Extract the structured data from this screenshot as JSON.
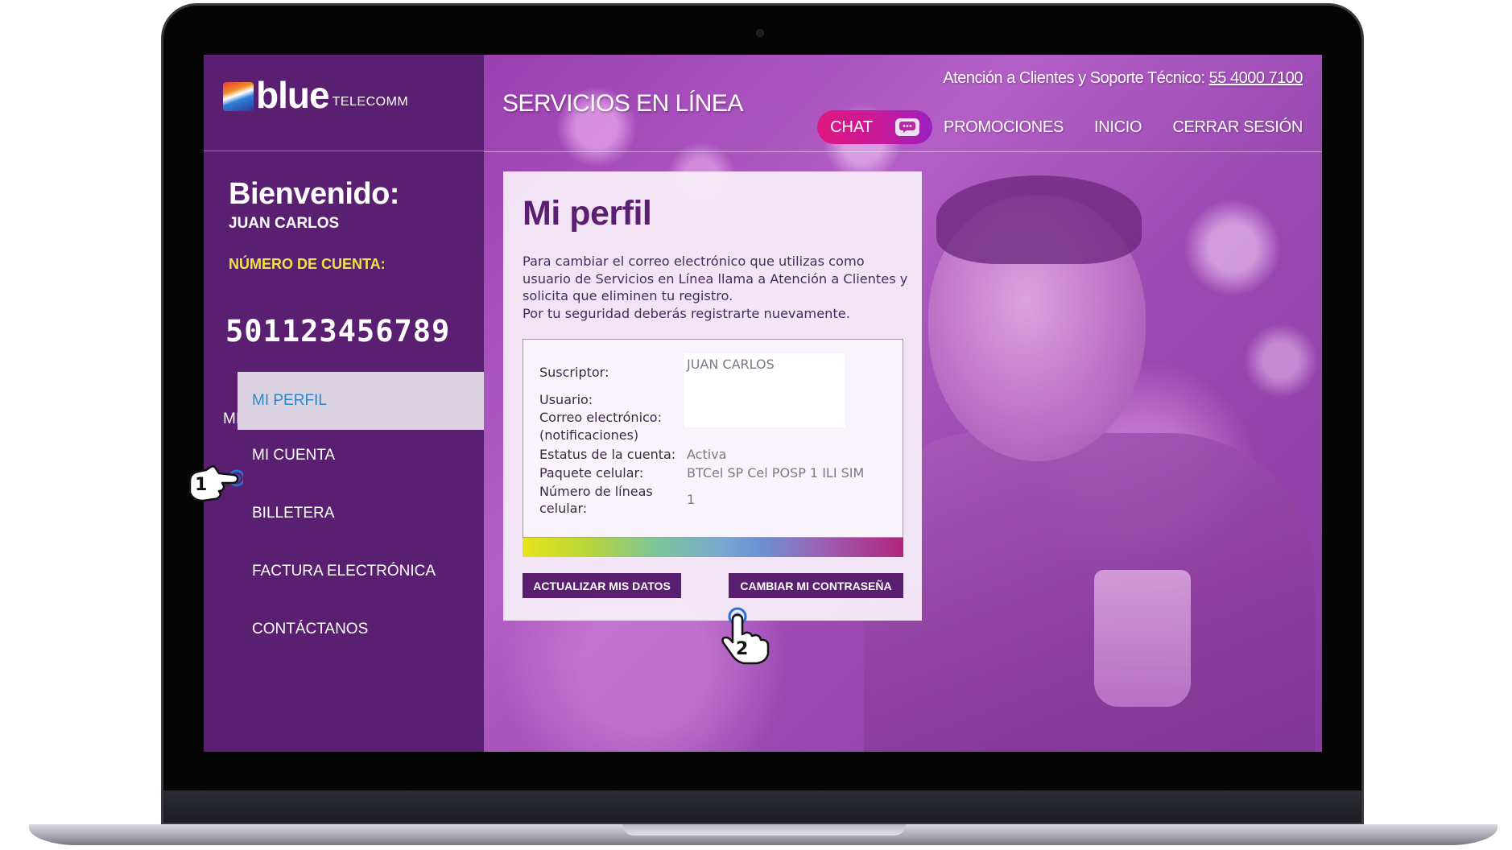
{
  "brand": {
    "name": "blue",
    "suffix": "TELECOMM"
  },
  "header": {
    "title": "SERVICIOS EN LÍNEA",
    "support_label": "Atención a Clientes y Soporte Técnico:",
    "support_phone": "55 4000 7100",
    "nav": {
      "chat": "CHAT",
      "promos": "PROMOCIONES",
      "inicio": "INICIO",
      "logout": "CERRAR SESIÓN"
    }
  },
  "sidebar": {
    "welcome": "Bienvenido:",
    "username": "JUAN CARLOS",
    "account_label": "NÚMERO DE CUENTA:",
    "account_number": "501123456789",
    "menu_header": "MI CUENTA",
    "menu_caret": "^",
    "items": [
      {
        "label": "MI PERFIL",
        "active": true
      },
      {
        "label": "MI CUENTA"
      },
      {
        "label": "BILLETERA"
      },
      {
        "label": "FACTURA ELECTRÓNICA"
      },
      {
        "label": "CONTÁCTANOS"
      }
    ]
  },
  "profile": {
    "title": "Mi perfil",
    "description": "Para cambiar el correo electrónico que utilizas como usuario de Servicios en Línea llama a Atención a Clientes y solicita que eliminen tu registro.",
    "description_2": "Por tu seguridad deberás registrarte nuevamente.",
    "fields": {
      "subscriber_label": "Suscriptor:",
      "subscriber_value": "JUAN CARLOS",
      "user_label": "Usuario:",
      "email_label": "Correo electrónico:",
      "email_label_2": "(notificaciones)",
      "status_label": "Estatus de la cuenta:",
      "status_value": "Activa",
      "package_label": "Paquete celular:",
      "package_value": "BTCel SP Cel POSP 1 ILI SIM",
      "lines_label": "Número de líneas",
      "lines_label_2": "celular:",
      "lines_value": "1"
    },
    "buttons": {
      "update": "ACTUALIZAR MIS DATOS",
      "change_password": "CAMBIAR MI CONTRASEÑA"
    }
  },
  "annotations": {
    "step1": "1",
    "step2": "2"
  },
  "colors": {
    "sidebar": "#5b1f72",
    "accent": "#5b1f72",
    "chat_pink": "#e0177f",
    "account_label": "#f2e24a"
  }
}
